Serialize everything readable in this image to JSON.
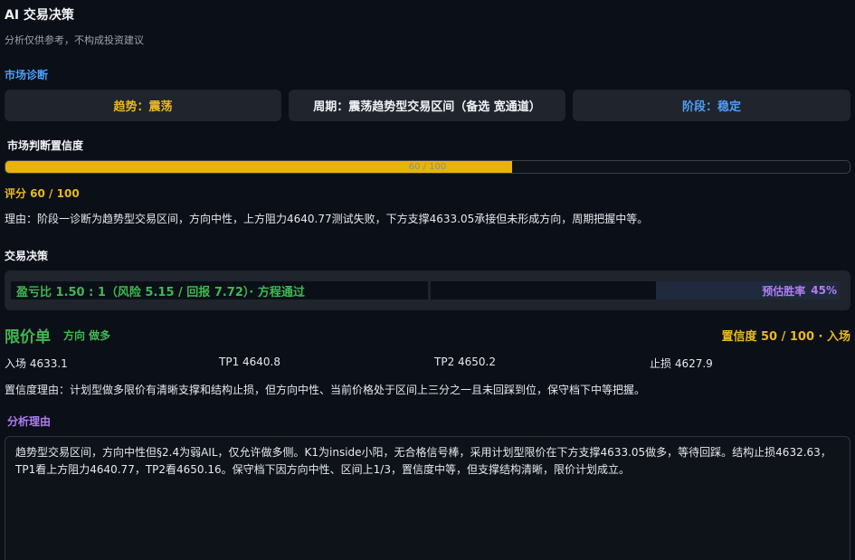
{
  "header": {
    "title": "AI 交易决策",
    "subtitle": "分析仅供参考，不构成投资建议"
  },
  "diagnosis": {
    "section_title": "市场诊断",
    "trend": "趋势：震荡",
    "cycle": "周期：震荡趋势型交易区间（备选 宽通道）",
    "stage": "阶段：稳定"
  },
  "confidence": {
    "section_title": "市场判断置信度",
    "bar_text": "60 / 100",
    "score_fraction": 0.6,
    "score_text": "评分 60 / 100",
    "reason": "理由：阶段一诊断为趋势型交易区间，方向中性，上方阻力4640.77测试失败，下方支撑4633.05承接但未形成方向，周期把握中等。"
  },
  "decision": {
    "section_title": "交易决策",
    "risk_reward": "盈亏比  1.50 : 1（风险 5.15 / 回报 7.72）· 方程通过",
    "winrate_label": "预估胜率",
    "winrate_value": "45%",
    "winrate_fraction": 0.45
  },
  "order": {
    "type": "限价单",
    "direction": "方向 做多",
    "confidence": "置信度 50 / 100 · 入场",
    "entry": "入场  4633.1",
    "tp1": "TP1  4640.8",
    "tp2": "TP2  4650.2",
    "stop": "止损  4627.9",
    "confidence_reason": "置信度理由：计划型做多限价有清晰支撑和结构止损，但方向中性、当前价格处于区间上三分之一且未回踩到位，保守档下中等把握。"
  },
  "analysis": {
    "section_title": "分析理由",
    "text": "趋势型交易区间，方向中性但§2.4为弱AIL，仅允许做多侧。K1为inside小阳，无合格信号棒，采用计划型限价在下方支撑4633.05做多，等待回踩。结构止损4632.63，TP1看上方阻力4640.77，TP2看4650.16。保守档下因方向中性、区间上1/3，置信度中等，但支撑结构清晰，限价计划成立。"
  },
  "colors": {
    "background": "#0b0f17",
    "panel": "#1f242d",
    "yellow": "#e8b820",
    "blue": "#4d9ef7",
    "green": "#3fb950",
    "purple": "#b07df5"
  }
}
